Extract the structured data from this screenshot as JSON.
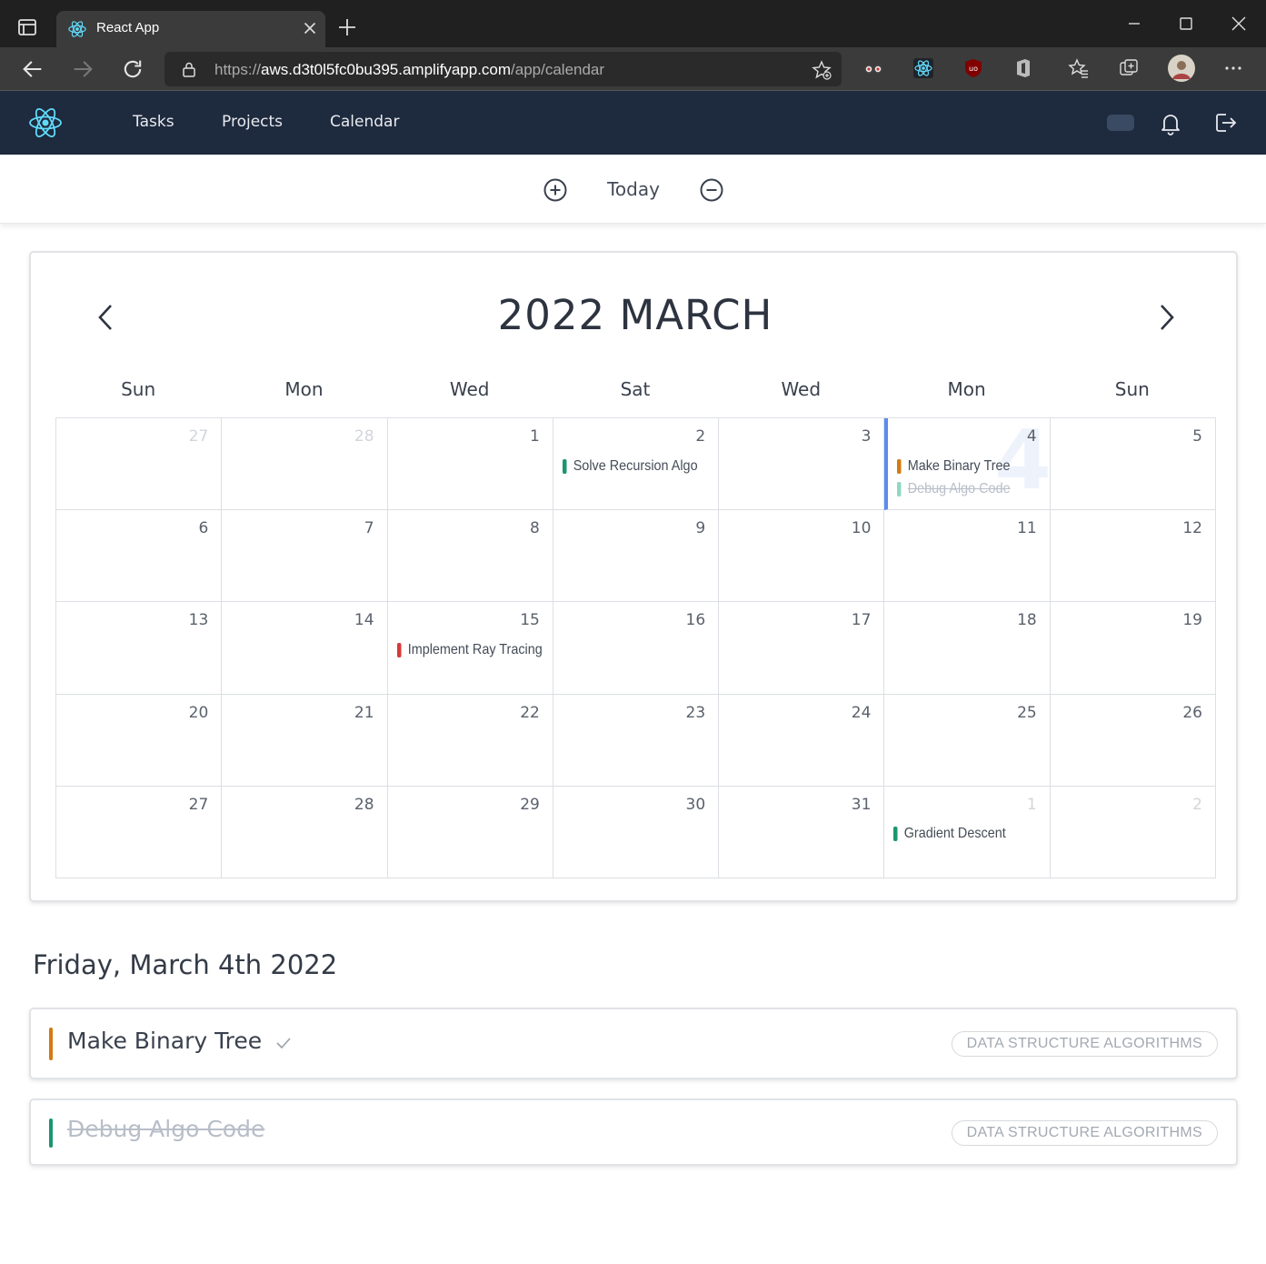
{
  "browser": {
    "tab_title": "React App",
    "url_scheme": "https://",
    "url_host": "aws.d3t0l5fc0bu395.amplifyapp.com",
    "url_path": "/app/calendar"
  },
  "app": {
    "nav": [
      "Tasks",
      "Projects",
      "Calendar"
    ]
  },
  "zoom": {
    "today_label": "Today"
  },
  "calendar": {
    "title": "2022 MARCH",
    "weekdays": [
      "Sun",
      "Mon",
      "Wed",
      "Sat",
      "Wed",
      "Mon",
      "Sun"
    ],
    "selected_big_number": "4",
    "colors": {
      "green": "#1a9671",
      "orange": "#d47a12",
      "red": "#d63a3a",
      "teal_light": "#8fd8c4",
      "selected": "#5b8def"
    },
    "weeks": [
      [
        {
          "day": "27",
          "muted": true
        },
        {
          "day": "28",
          "muted": true
        },
        {
          "day": "1"
        },
        {
          "day": "2",
          "events": [
            {
              "title": "Solve Recursion Algo",
              "color": "#1a9671"
            }
          ]
        },
        {
          "day": "3"
        },
        {
          "day": "4",
          "selected": true,
          "events": [
            {
              "title": "Make Binary Tree",
              "color": "#d47a12"
            },
            {
              "title": "Debug Algo Code",
              "color": "#8fd8c4",
              "done": true
            }
          ]
        },
        {
          "day": "5"
        }
      ],
      [
        {
          "day": "6"
        },
        {
          "day": "7"
        },
        {
          "day": "8"
        },
        {
          "day": "9"
        },
        {
          "day": "10"
        },
        {
          "day": "11"
        },
        {
          "day": "12"
        }
      ],
      [
        {
          "day": "13"
        },
        {
          "day": "14"
        },
        {
          "day": "15",
          "events": [
            {
              "title": "Implement Ray Tracing",
              "color": "#d63a3a"
            }
          ]
        },
        {
          "day": "16"
        },
        {
          "day": "17"
        },
        {
          "day": "18"
        },
        {
          "day": "19"
        }
      ],
      [
        {
          "day": "20"
        },
        {
          "day": "21"
        },
        {
          "day": "22"
        },
        {
          "day": "23"
        },
        {
          "day": "24"
        },
        {
          "day": "25"
        },
        {
          "day": "26"
        }
      ],
      [
        {
          "day": "27"
        },
        {
          "day": "28"
        },
        {
          "day": "29"
        },
        {
          "day": "30"
        },
        {
          "day": "31"
        },
        {
          "day": "1",
          "muted": true,
          "events": [
            {
              "title": "Gradient Descent",
              "color": "#1a9671"
            }
          ]
        },
        {
          "day": "2",
          "muted": true
        }
      ]
    ]
  },
  "day_detail": {
    "title": "Friday, March 4th 2022",
    "tasks": [
      {
        "title": "Make Binary Tree",
        "tag": "DATA STRUCTURE ALGORITHMS",
        "color": "#d47a12",
        "done": false
      },
      {
        "title": "Debug Algo Code",
        "tag": "DATA STRUCTURE ALGORITHMS",
        "color": "#1a9671",
        "done": true
      }
    ]
  }
}
